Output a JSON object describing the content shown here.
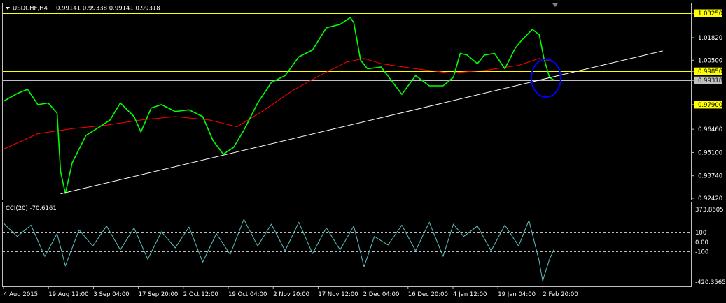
{
  "header": {
    "symbol": "USDCHF,H4",
    "ohlc": "0.99141 0.99338 0.99141 0.99318"
  },
  "indicator": {
    "label": "CCI(20) -70.6161"
  },
  "chart_data": [
    {
      "type": "line",
      "title": "",
      "xlabel": "",
      "ylabel": "",
      "ylim": [
        0.9242,
        1.0325
      ],
      "y_ticks": [
        "1.03250",
        "1.01820",
        "1.00500",
        "0.99850",
        "0.99318",
        "0.97900",
        "0.96460",
        "0.95100",
        "0.93740",
        "0.92420"
      ],
      "x_ticks": [
        "4 Aug 2015",
        "19 Aug 12:00",
        "3 Sep 04:00",
        "17 Sep 20:00",
        "2 Oct 12:00",
        "19 Oct 04:00",
        "2 Nov 20:00",
        "17 Nov 12:00",
        "2 Dec 04:00",
        "16 Dec 20:00",
        "4 Jan 12:00",
        "19 Jan 04:00",
        "2 Feb 20:00"
      ],
      "horizontal_levels": [
        {
          "value": 1.0325,
          "color": "#ffff00",
          "label": "1.03250"
        },
        {
          "value": 0.9985,
          "color": "#ffff00",
          "label": "0.99850"
        },
        {
          "value": 0.979,
          "color": "#ffff00",
          "label": "0.97900"
        },
        {
          "value": 0.99318,
          "color": "#c0c0c0",
          "label": "0.99318"
        }
      ],
      "series": [
        {
          "color": "#00ff00",
          "x": [
            0,
            0.02,
            0.035,
            0.05,
            0.065,
            0.078,
            0.083,
            0.09,
            0.1,
            0.12,
            0.14,
            0.155,
            0.17,
            0.19,
            0.2,
            0.215,
            0.23,
            0.25,
            0.27,
            0.29,
            0.305,
            0.32,
            0.335,
            0.35,
            0.37,
            0.39,
            0.41,
            0.43,
            0.45,
            0.47,
            0.49,
            0.505,
            0.51,
            0.52,
            0.53,
            0.55,
            0.565,
            0.58,
            0.6,
            0.62,
            0.64,
            0.655,
            0.665,
            0.675,
            0.69,
            0.7,
            0.715,
            0.73,
            0.745,
            0.755,
            0.77,
            0.78,
            0.787,
            0.795,
            0.802
          ],
          "y": [
            0.981,
            0.9855,
            0.988,
            0.979,
            0.98,
            0.974,
            0.94,
            0.927,
            0.945,
            0.961,
            0.966,
            0.97,
            0.98,
            0.972,
            0.963,
            0.977,
            0.979,
            0.975,
            0.976,
            0.972,
            0.958,
            0.95,
            0.954,
            0.964,
            0.98,
            0.992,
            0.996,
            1.007,
            1.011,
            1.024,
            1.026,
            1.03,
            1.027,
            1.005,
            1.0,
            1.001,
            0.993,
            0.985,
            0.996,
            0.99,
            0.99,
            0.995,
            1.009,
            1.008,
            1.003,
            1.008,
            1.009,
            1.0,
            1.012,
            1.017,
            1.023,
            1.02,
            1.006,
            0.995,
            0.9932
          ]
        },
        {
          "color": "#ff0000",
          "x": [
            0,
            0.05,
            0.1,
            0.15,
            0.2,
            0.25,
            0.3,
            0.34,
            0.38,
            0.42,
            0.46,
            0.5,
            0.525,
            0.55,
            0.6,
            0.65,
            0.7,
            0.75,
            0.78,
            0.802
          ],
          "y": [
            0.953,
            0.962,
            0.965,
            0.967,
            0.97,
            0.972,
            0.97,
            0.966,
            0.976,
            0.987,
            0.996,
            1.004,
            1.006,
            1.003,
            1.0,
            0.9975,
            0.999,
            1.002,
            1.006,
            1.004
          ]
        }
      ],
      "trendline": {
        "color": "#ffffff",
        "from": [
          0.083,
          0.9268
        ],
        "to": [
          0.96,
          1.0105
        ]
      },
      "annotation": {
        "type": "ellipse",
        "color": "#0000ff",
        "center": [
          0.79,
          0.9945
        ]
      }
    },
    {
      "type": "line",
      "title": "CCI(20) -70.6161",
      "ylim": [
        -420.3565,
        373.8605
      ],
      "y_ticks": [
        "373.8605",
        "100",
        "0.00",
        "-100",
        "-420.3565"
      ],
      "levels": [
        100,
        -100
      ],
      "series": [
        {
          "color": "#5fc0c0",
          "x": [
            0,
            0.02,
            0.04,
            0.06,
            0.078,
            0.09,
            0.11,
            0.13,
            0.15,
            0.17,
            0.19,
            0.21,
            0.23,
            0.25,
            0.27,
            0.29,
            0.31,
            0.33,
            0.35,
            0.37,
            0.39,
            0.41,
            0.43,
            0.45,
            0.47,
            0.49,
            0.51,
            0.525,
            0.54,
            0.56,
            0.58,
            0.6,
            0.62,
            0.64,
            0.655,
            0.67,
            0.69,
            0.71,
            0.73,
            0.75,
            0.765,
            0.78,
            0.785,
            0.795,
            0.802
          ],
          "y": [
            200,
            60,
            180,
            -150,
            90,
            -250,
            130,
            -40,
            170,
            -80,
            150,
            -180,
            110,
            -60,
            160,
            -210,
            90,
            -130,
            240,
            -40,
            190,
            -90,
            210,
            -120,
            150,
            -80,
            170,
            -260,
            60,
            -30,
            180,
            -90,
            210,
            -150,
            190,
            60,
            170,
            -90,
            180,
            -40,
            230,
            -200,
            -410,
            -180,
            -70.6
          ]
        }
      ]
    }
  ]
}
